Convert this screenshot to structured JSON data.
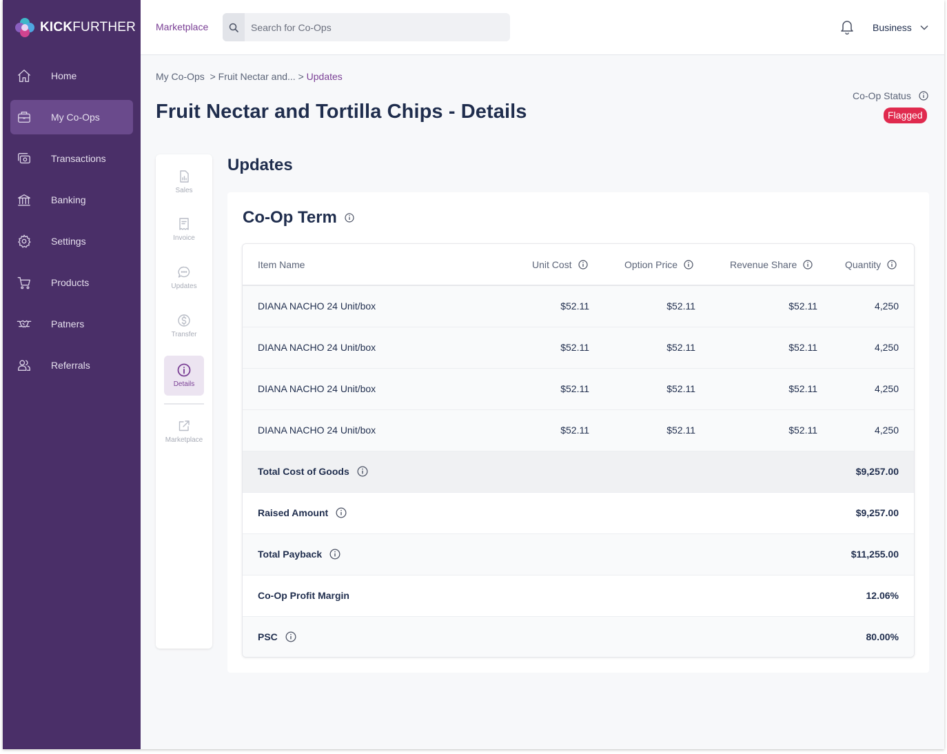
{
  "brand": {
    "bold": "KICK",
    "light": "FURTHER"
  },
  "sidebar": {
    "items": [
      {
        "label": "Home",
        "icon": "home-icon"
      },
      {
        "label": "My Co-Ops",
        "icon": "briefcase-icon",
        "active": true
      },
      {
        "label": "Transactions",
        "icon": "cash-icon"
      },
      {
        "label": "Banking",
        "icon": "bank-icon"
      },
      {
        "label": "Settings",
        "icon": "gear-icon"
      },
      {
        "label": "Products",
        "icon": "cart-icon"
      },
      {
        "label": "Patners",
        "icon": "handshake-icon"
      },
      {
        "label": "Referrals",
        "icon": "users-icon"
      }
    ]
  },
  "topbar": {
    "marketplace_link": "Marketplace",
    "search_placeholder": "Search for Co-Ops",
    "account_label": "Business"
  },
  "breadcrumb": {
    "root": "My Co-Ops",
    "middle": "> Fruit Nectar and...",
    "sep": ">",
    "current": "Updates"
  },
  "page": {
    "title": "Fruit Nectar and Tortilla Chips - Details",
    "status_label": "Co-Op Status",
    "status_value": "Flagged",
    "status_color": "#e02a4e"
  },
  "mini_nav": [
    {
      "label": "Sales",
      "icon": "chart-doc-icon"
    },
    {
      "label": "Invoice",
      "icon": "invoice-icon"
    },
    {
      "label": "Updates",
      "icon": "chat-icon"
    },
    {
      "label": "Transfer",
      "icon": "dollar-icon"
    },
    {
      "label": "Details",
      "icon": "info-icon",
      "active": true
    },
    {
      "label": "Marketplace",
      "icon": "external-link-icon"
    }
  ],
  "section_title": "Updates",
  "card": {
    "title": "Co-Op Term",
    "columns": {
      "item_name": "Item Name",
      "unit_cost": "Unit Cost",
      "option_price": "Option Price",
      "revenue_share": "Revenue Share",
      "quantity": "Quantity"
    },
    "rows": [
      {
        "name": "DIANA NACHO 24 Unit/box",
        "unit_cost": "$52.11",
        "option_price": "$52.11",
        "revenue_share": "$52.11",
        "quantity": "4,250"
      },
      {
        "name": "DIANA NACHO 24 Unit/box",
        "unit_cost": "$52.11",
        "option_price": "$52.11",
        "revenue_share": "$52.11",
        "quantity": "4,250"
      },
      {
        "name": "DIANA NACHO 24 Unit/box",
        "unit_cost": "$52.11",
        "option_price": "$52.11",
        "revenue_share": "$52.11",
        "quantity": "4,250"
      },
      {
        "name": "DIANA NACHO 24 Unit/box",
        "unit_cost": "$52.11",
        "option_price": "$52.11",
        "revenue_share": "$52.11",
        "quantity": "4,250"
      }
    ],
    "summary": [
      {
        "label": "Total Cost of Goods",
        "value": "$9,257.00"
      },
      {
        "label": "Raised Amount",
        "value": "$9,257.00"
      },
      {
        "label": "Total Payback",
        "value": "$11,255.00"
      },
      {
        "label": "Co-Op Profit Margin",
        "value": "12.06%"
      },
      {
        "label": "PSC",
        "value": "80.00%"
      }
    ]
  },
  "colors": {
    "sidebar_bg": "#4a2f68",
    "accent": "#7a3f95",
    "text_dark": "#1f2d4d"
  }
}
